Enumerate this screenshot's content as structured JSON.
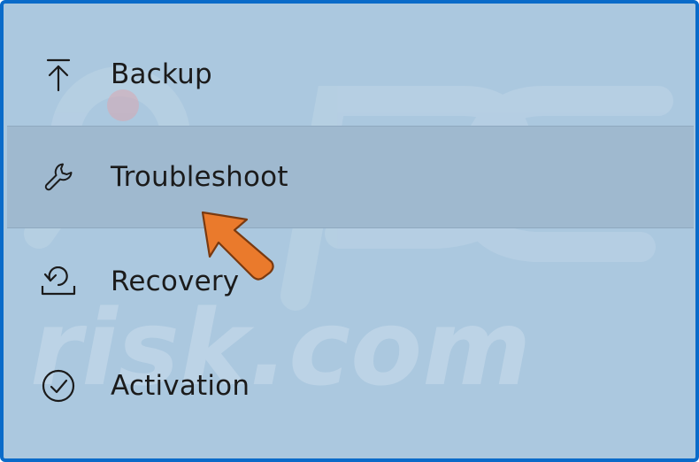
{
  "menu": {
    "items": [
      {
        "label": "Backup",
        "icon": "upload-arrow-icon",
        "selected": false
      },
      {
        "label": "Troubleshoot",
        "icon": "wrench-icon",
        "selected": true
      },
      {
        "label": "Recovery",
        "icon": "recovery-icon",
        "selected": false
      },
      {
        "label": "Activation",
        "icon": "check-circle-icon",
        "selected": false
      }
    ]
  },
  "watermark": {
    "text": "risk.com",
    "logo": "pc"
  },
  "colors": {
    "frame_border": "#0a6bc9",
    "background": "#abc8df",
    "selected_background": "#9fb9cf",
    "text": "#1b1b1b",
    "pointer_arrow": "#ea7a2c"
  },
  "annotation": {
    "icon": "pointer-arrow-icon"
  }
}
